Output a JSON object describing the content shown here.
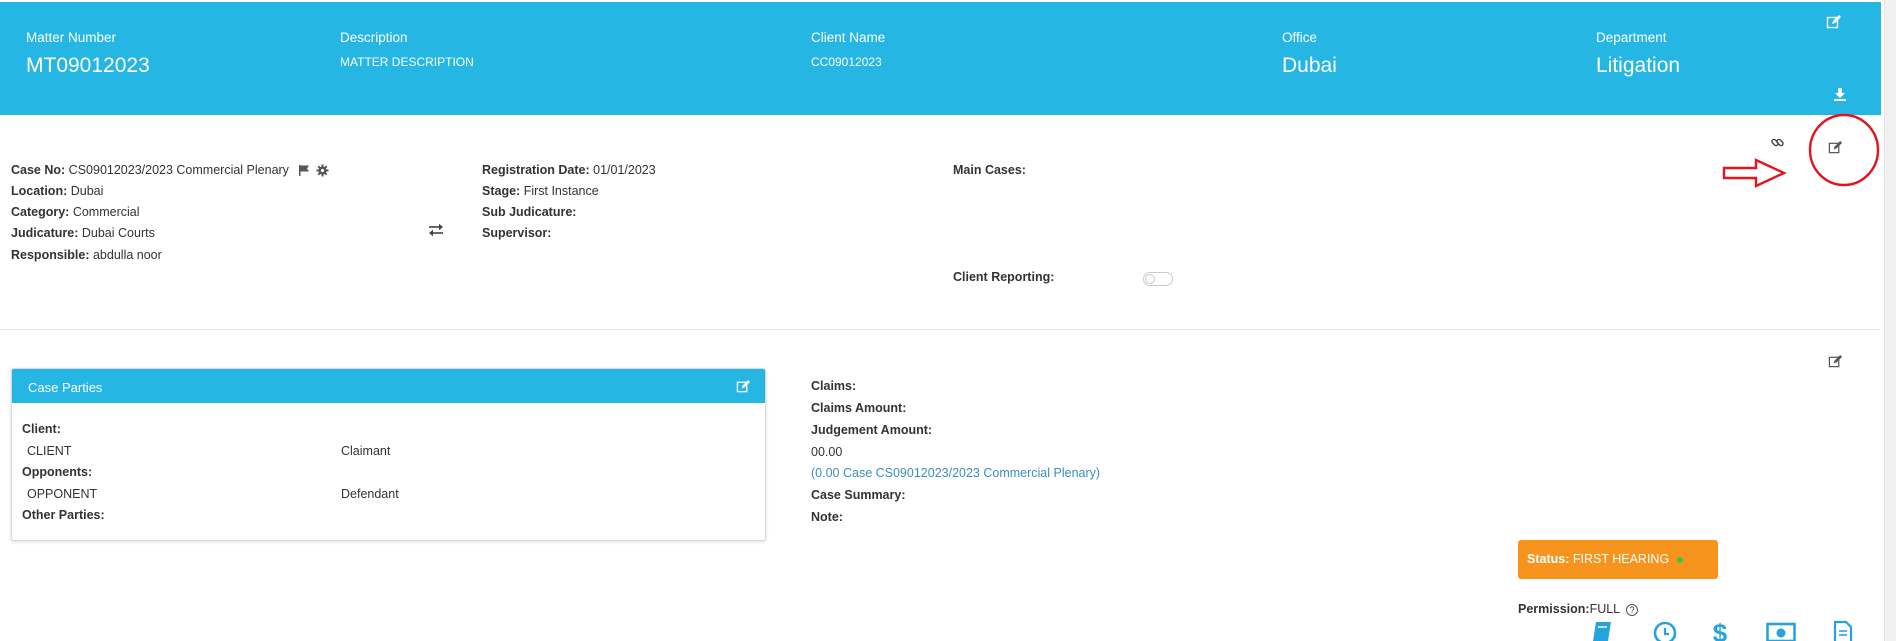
{
  "header": {
    "matter_number_label": "Matter Number",
    "matter_number": "MT09012023",
    "description_label": "Description",
    "description": "MATTER DESCRIPTION",
    "client_name_label": "Client Name",
    "client_name": "CC09012023",
    "office_label": "Office",
    "office": "Dubai",
    "department_label": "Department",
    "department": "Litigation"
  },
  "case_info": {
    "left": [
      {
        "label": "Case No:",
        "value": "CS09012023/2023 Commercial Plenary"
      },
      {
        "label": "Location:",
        "value": "Dubai"
      },
      {
        "label": "Category:",
        "value": "Commercial"
      },
      {
        "label": "Judicature:",
        "value": "Dubai Courts"
      },
      {
        "label": "Responsible:",
        "value": "abdulla noor"
      }
    ],
    "middle": [
      {
        "label": "Registration Date:",
        "value": "01/01/2023"
      },
      {
        "label": "Stage:",
        "value": "First Instance"
      },
      {
        "label": "Sub Judicature:",
        "value": ""
      },
      {
        "label": "Supervisor:",
        "value": ""
      }
    ],
    "main_cases_label": "Main Cases:",
    "client_reporting_label": "Client Reporting:",
    "client_reporting_on": false
  },
  "parties": {
    "title": "Case Parties",
    "client_label": "Client:",
    "client_name": "CLIENT",
    "client_role": "Claimant",
    "opponents_label": "Opponents:",
    "opponent_name": "OPPONENT",
    "opponent_role": "Defendant",
    "other_parties_label": "Other Parties:"
  },
  "claims": {
    "claims_label": "Claims:",
    "claims_amount_label": "Claims Amount:",
    "judgement_amount_label": "Judgement Amount:",
    "judgement_amount": "00.00",
    "related_link": "(0.00 Case CS09012023/2023 Commercial Plenary)",
    "case_summary_label": "Case Summary:",
    "note_label": "Note:"
  },
  "status": {
    "label": "Status:",
    "value": "FIRST HEARING",
    "color": "#f7941d"
  },
  "permission": {
    "label": "Permission:",
    "value": "FULL",
    "help": "?"
  },
  "theme": {
    "primary": "#26b6e4",
    "link": "#3c8dbc",
    "annotation": "#e3141b"
  },
  "icons": [
    "edit-icon",
    "download-icon",
    "flag-icon",
    "gear-icon",
    "swap-icon",
    "link-icon",
    "book-icon",
    "clock-icon",
    "dollar-icon",
    "cash-icon",
    "document-icon"
  ]
}
